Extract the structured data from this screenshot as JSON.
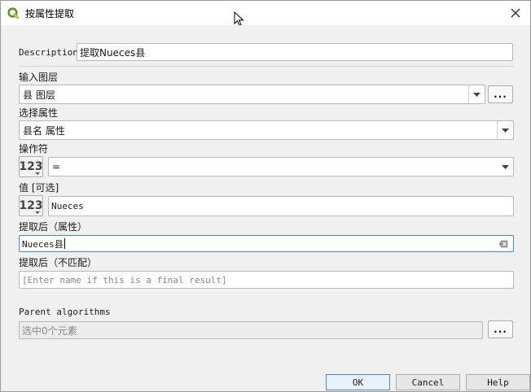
{
  "window": {
    "title": "按属性提取"
  },
  "form": {
    "description": {
      "label": "Description",
      "value": "提取Nueces县"
    },
    "input_layer": {
      "label": "输入图层",
      "value": "县 图层",
      "more_label": "..."
    },
    "attribute": {
      "label": "选择属性",
      "value": "县名 属性"
    },
    "operator": {
      "label": "操作符",
      "value": "=",
      "type_badge": "123"
    },
    "value": {
      "label": "值 [可选]",
      "value": "Nueces",
      "type_badge": "123"
    },
    "extracted": {
      "label": "提取后（属性）",
      "value": "Nueces县"
    },
    "unmatched": {
      "label": "提取后（不匹配）",
      "placeholder": "[Enter name if this is a final result]"
    },
    "parent": {
      "label": "Parent algorithms",
      "value": "选中0个元素",
      "more_label": "..."
    }
  },
  "buttons": {
    "ok": "OK",
    "cancel": "Cancel",
    "help": "Help"
  },
  "colors": {
    "accent": "#3d8edb",
    "qgis_green": "#589632",
    "qgis_yellow": "#f0b31f"
  }
}
